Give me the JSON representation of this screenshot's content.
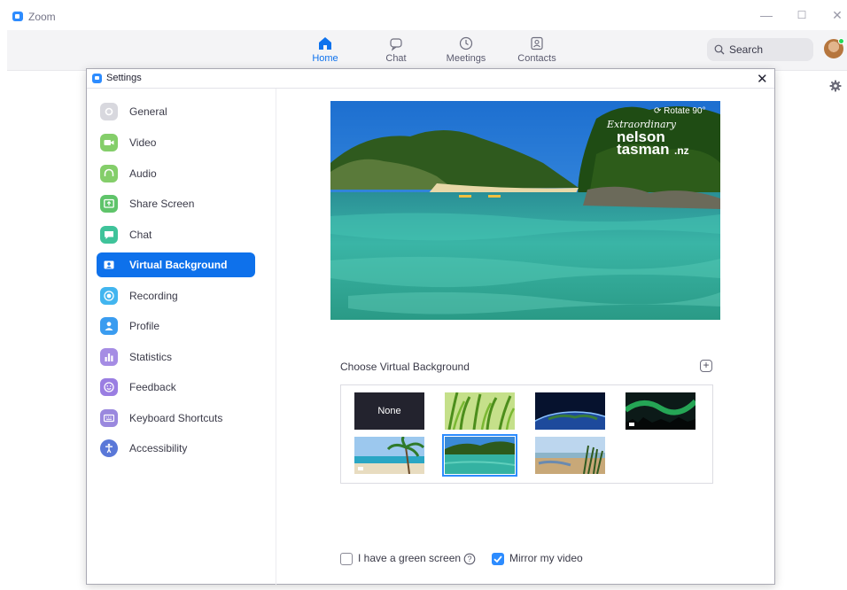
{
  "app": {
    "title": "Zoom"
  },
  "window_controls": {
    "minimize": "—",
    "maximize": "☐",
    "close": "✕"
  },
  "nav": {
    "tabs": [
      {
        "label": "Home",
        "icon": "home-icon",
        "active": true
      },
      {
        "label": "Chat",
        "icon": "chat-bubble-icon",
        "active": false
      },
      {
        "label": "Meetings",
        "icon": "clock-icon",
        "active": false
      },
      {
        "label": "Contacts",
        "icon": "contact-card-icon",
        "active": false
      }
    ],
    "search_label": "Search"
  },
  "settings": {
    "title": "Settings",
    "close": "✕",
    "sidebar": [
      {
        "label": "General",
        "icon": "gear-icon",
        "color": "#d8d8de"
      },
      {
        "label": "Video",
        "icon": "video-camera-icon",
        "color": "#84ce6a"
      },
      {
        "label": "Audio",
        "icon": "headphones-icon",
        "color": "#84ce6a"
      },
      {
        "label": "Share Screen",
        "icon": "share-screen-icon",
        "color": "#5fc46a"
      },
      {
        "label": "Chat",
        "icon": "chat-bubble-icon",
        "color": "#3fc39a"
      },
      {
        "label": "Virtual Background",
        "icon": "person-badge-icon",
        "color": "#0e71eb",
        "active": true
      },
      {
        "label": "Recording",
        "icon": "record-icon",
        "color": "#42b5ef"
      },
      {
        "label": "Profile",
        "icon": "person-icon",
        "color": "#3a9cf0"
      },
      {
        "label": "Statistics",
        "icon": "bar-chart-icon",
        "color": "#a58ce4"
      },
      {
        "label": "Feedback",
        "icon": "smiley-icon",
        "color": "#9a7ee2"
      },
      {
        "label": "Keyboard Shortcuts",
        "icon": "keyboard-icon",
        "color": "#9a88de"
      },
      {
        "label": "Accessibility",
        "icon": "accessibility-icon",
        "color": "#5a78d8"
      }
    ],
    "preview": {
      "rotate_label": "Rotate 90°",
      "watermark": "Extraordinary nelson tasman.nz"
    },
    "choose_label": "Choose Virtual Background",
    "backgrounds": [
      {
        "name": "None"
      },
      {
        "name": "grass"
      },
      {
        "name": "earth"
      },
      {
        "name": "aurora"
      },
      {
        "name": "beach-palm"
      },
      {
        "name": "golden-bay",
        "selected": true
      },
      {
        "name": "estuary"
      }
    ],
    "green_screen": {
      "label": "I have a green screen",
      "checked": false
    },
    "mirror": {
      "label": "Mirror my video",
      "checked": true
    }
  }
}
